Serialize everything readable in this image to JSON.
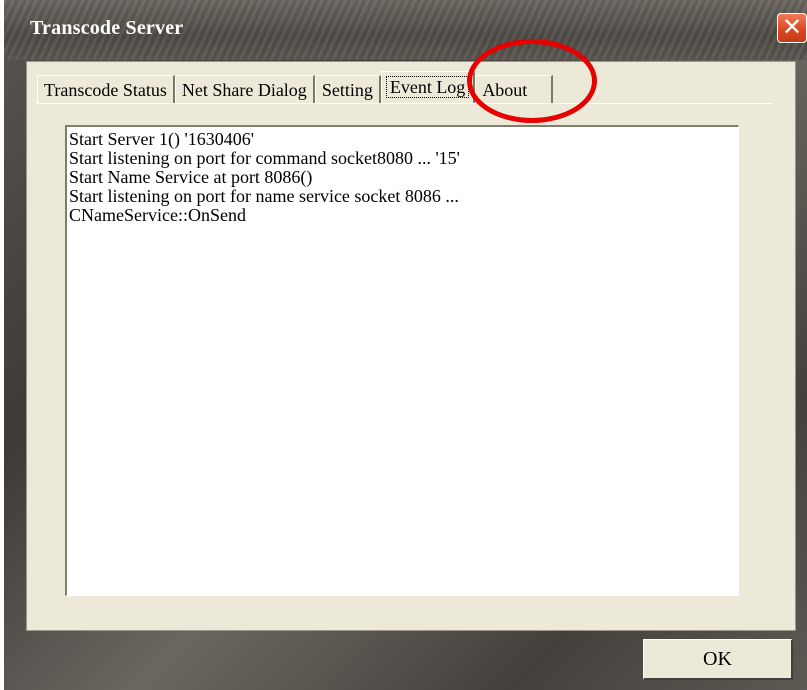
{
  "window": {
    "title": "Transcode Server",
    "close_symbol": "✕",
    "accent_color": "#e60000"
  },
  "tabs": [
    {
      "label": "Transcode Status",
      "active": false
    },
    {
      "label": "Net Share Dialog",
      "active": false
    },
    {
      "label": "Setting",
      "active": false
    },
    {
      "label": "Event Log",
      "active": true
    },
    {
      "label": "About",
      "active": false
    }
  ],
  "event_log": {
    "lines": [
      "Start Server 1() '1630406'",
      "Start listening on port for command socket8080 ... '15'",
      "Start Name Service at port 8086()",
      "Start listening on port for name service socket 8086 ...",
      "CNameService::OnSend"
    ]
  },
  "footer": {
    "ok_label": "OK"
  }
}
